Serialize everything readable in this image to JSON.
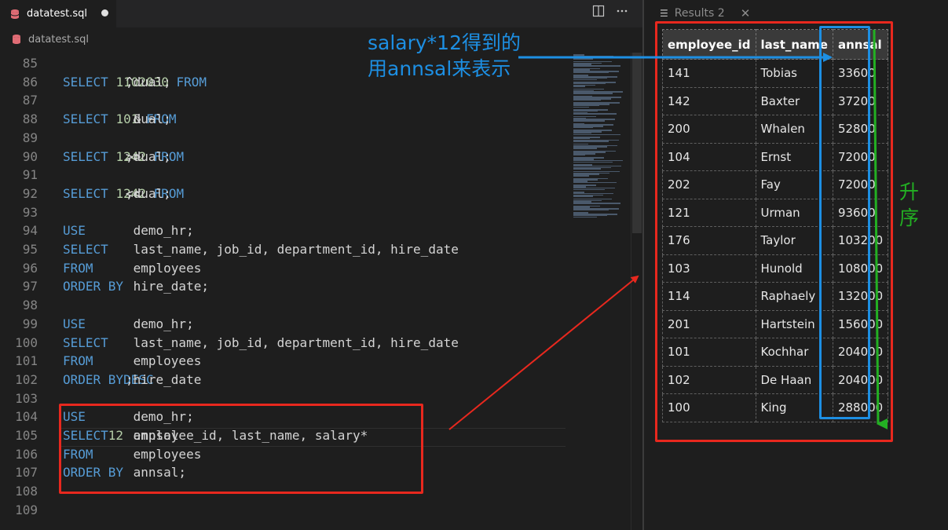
{
  "editor": {
    "tab_label": "datatest.sql",
    "breadcrumb": "datatest.sql",
    "lines": [
      {
        "n": "85",
        "parts": []
      },
      {
        "n": "86",
        "parts": [
          [
            "kw",
            "SELECT "
          ],
          [
            "num",
            "1"
          ],
          [
            "txt",
            "^"
          ],
          [
            "num",
            "10"
          ],
          [
            "txt",
            ", "
          ],
          [
            "num",
            "20"
          ],
          [
            "txt",
            "^"
          ],
          [
            "num",
            "30"
          ],
          [
            "kw",
            " FROM"
          ],
          [
            "txt",
            " dual;"
          ]
        ]
      },
      {
        "n": "87",
        "parts": []
      },
      {
        "n": "88",
        "parts": [
          [
            "kw",
            "SELECT "
          ],
          [
            "num",
            "10"
          ],
          [
            "txt",
            " & ~"
          ],
          [
            "num",
            "1"
          ],
          [
            "kw",
            " FROM"
          ],
          [
            "txt",
            " dual;"
          ]
        ]
      },
      {
        "n": "89",
        "parts": []
      },
      {
        "n": "90",
        "parts": [
          [
            "kw",
            "SELECT "
          ],
          [
            "num",
            "1"
          ],
          [
            "txt",
            ">>"
          ],
          [
            "num",
            "2"
          ],
          [
            "txt",
            ", "
          ],
          [
            "num",
            "4"
          ],
          [
            "txt",
            ">>"
          ],
          [
            "num",
            "2"
          ],
          [
            "kw",
            " FROM"
          ],
          [
            "txt",
            " dual;"
          ]
        ]
      },
      {
        "n": "91",
        "parts": []
      },
      {
        "n": "92",
        "parts": [
          [
            "kw",
            "SELECT "
          ],
          [
            "num",
            "1"
          ],
          [
            "txt",
            "<<"
          ],
          [
            "num",
            "2"
          ],
          [
            "txt",
            ", "
          ],
          [
            "num",
            "4"
          ],
          [
            "txt",
            "<<"
          ],
          [
            "num",
            "2"
          ],
          [
            "kw",
            " FROM"
          ],
          [
            "txt",
            " dual;"
          ]
        ]
      },
      {
        "n": "93",
        "parts": []
      },
      {
        "n": "94",
        "parts": [
          [
            "kw",
            "USE"
          ],
          [
            "txt",
            " demo_hr;"
          ]
        ]
      },
      {
        "n": "95",
        "parts": [
          [
            "kw",
            "SELECT"
          ],
          [
            "txt",
            " last_name, job_id, department_id, hire_date"
          ]
        ]
      },
      {
        "n": "96",
        "parts": [
          [
            "kw",
            "FROM"
          ],
          [
            "txt",
            " employees"
          ]
        ]
      },
      {
        "n": "97",
        "parts": [
          [
            "kw",
            "ORDER BY"
          ],
          [
            "txt",
            " hire_date;"
          ]
        ]
      },
      {
        "n": "98",
        "parts": []
      },
      {
        "n": "99",
        "parts": [
          [
            "kw",
            "USE"
          ],
          [
            "txt",
            " demo_hr;"
          ]
        ]
      },
      {
        "n": "100",
        "parts": [
          [
            "kw",
            "SELECT"
          ],
          [
            "txt",
            " last_name, job_id, department_id, hire_date"
          ]
        ]
      },
      {
        "n": "101",
        "parts": [
          [
            "kw",
            "FROM"
          ],
          [
            "txt",
            " employees"
          ]
        ]
      },
      {
        "n": "102",
        "parts": [
          [
            "kw",
            "ORDER BY"
          ],
          [
            "txt",
            " hire_date "
          ],
          [
            "kw",
            "DESC"
          ],
          [
            "txt",
            ";"
          ]
        ]
      },
      {
        "n": "103",
        "parts": []
      },
      {
        "n": "104",
        "parts": [
          [
            "kw",
            "USE"
          ],
          [
            "txt",
            " demo_hr;"
          ]
        ]
      },
      {
        "n": "105",
        "parts": [
          [
            "kw",
            "SELECT"
          ],
          [
            "txt",
            " employee_id, last_name, salary*"
          ],
          [
            "num",
            "12"
          ],
          [
            "txt",
            " annsal"
          ]
        ]
      },
      {
        "n": "106",
        "parts": [
          [
            "kw",
            "FROM"
          ],
          [
            "txt",
            " employees"
          ]
        ]
      },
      {
        "n": "107",
        "parts": [
          [
            "kw",
            "ORDER BY"
          ],
          [
            "txt",
            " annsal;"
          ]
        ]
      },
      {
        "n": "108",
        "parts": []
      },
      {
        "n": "109",
        "parts": []
      }
    ]
  },
  "results": {
    "tab_label": "Results 2",
    "columns": [
      "employee_id",
      "last_name",
      "annsal"
    ],
    "rows": [
      [
        "141",
        "Tobias",
        "33600"
      ],
      [
        "142",
        "Baxter",
        "37200"
      ],
      [
        "200",
        "Whalen",
        "52800"
      ],
      [
        "104",
        "Ernst",
        "72000"
      ],
      [
        "202",
        "Fay",
        "72000"
      ],
      [
        "121",
        "Urman",
        "93600"
      ],
      [
        "176",
        "Taylor",
        "103200"
      ],
      [
        "103",
        "Hunold",
        "108000"
      ],
      [
        "114",
        "Raphaely",
        "132000"
      ],
      [
        "201",
        "Hartstein",
        "156000"
      ],
      [
        "101",
        "Kochhar",
        "204000"
      ],
      [
        "102",
        "De Haan",
        "204000"
      ],
      [
        "100",
        "King",
        "288000"
      ]
    ]
  },
  "annotations": {
    "blue_line1": "salary*12得到的",
    "blue_line2": "用annsal来表示",
    "green_text": "升序"
  },
  "colors": {
    "keyword": "#569cd6",
    "number": "#b5cea8",
    "annotation_red": "#e8281e",
    "annotation_blue": "#1d8fe3",
    "annotation_green": "#23b023"
  },
  "icons": {
    "file": "database-icon",
    "split": "split-editor-icon",
    "more": "more-actions-icon",
    "results_menu": "menu-icon",
    "results_close": "close-icon"
  }
}
